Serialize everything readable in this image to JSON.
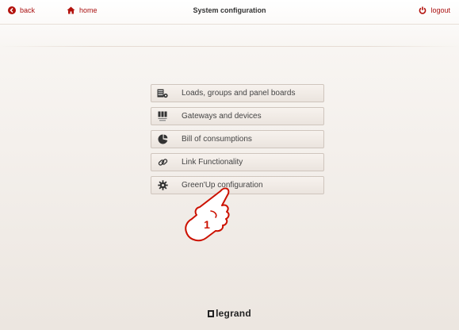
{
  "header": {
    "back_label": "back",
    "home_label": "home",
    "title": "System configuration",
    "logout_label": "logout"
  },
  "menu": {
    "items": [
      {
        "label": "Loads, groups and panel boards",
        "icon": "loads-icon"
      },
      {
        "label": "Gateways and devices",
        "icon": "gateway-icon"
      },
      {
        "label": "Bill of consumptions",
        "icon": "pie-chart-icon"
      },
      {
        "label": "Link Functionality",
        "icon": "link-icon"
      },
      {
        "label": "Green'Up configuration",
        "icon": "gear-icon"
      }
    ]
  },
  "annotation": {
    "step_number": "1"
  },
  "footer": {
    "brand": "legrand"
  },
  "colors": {
    "accent": "#b3120d",
    "text": "#444444",
    "button_border": "#cfc5bd"
  }
}
